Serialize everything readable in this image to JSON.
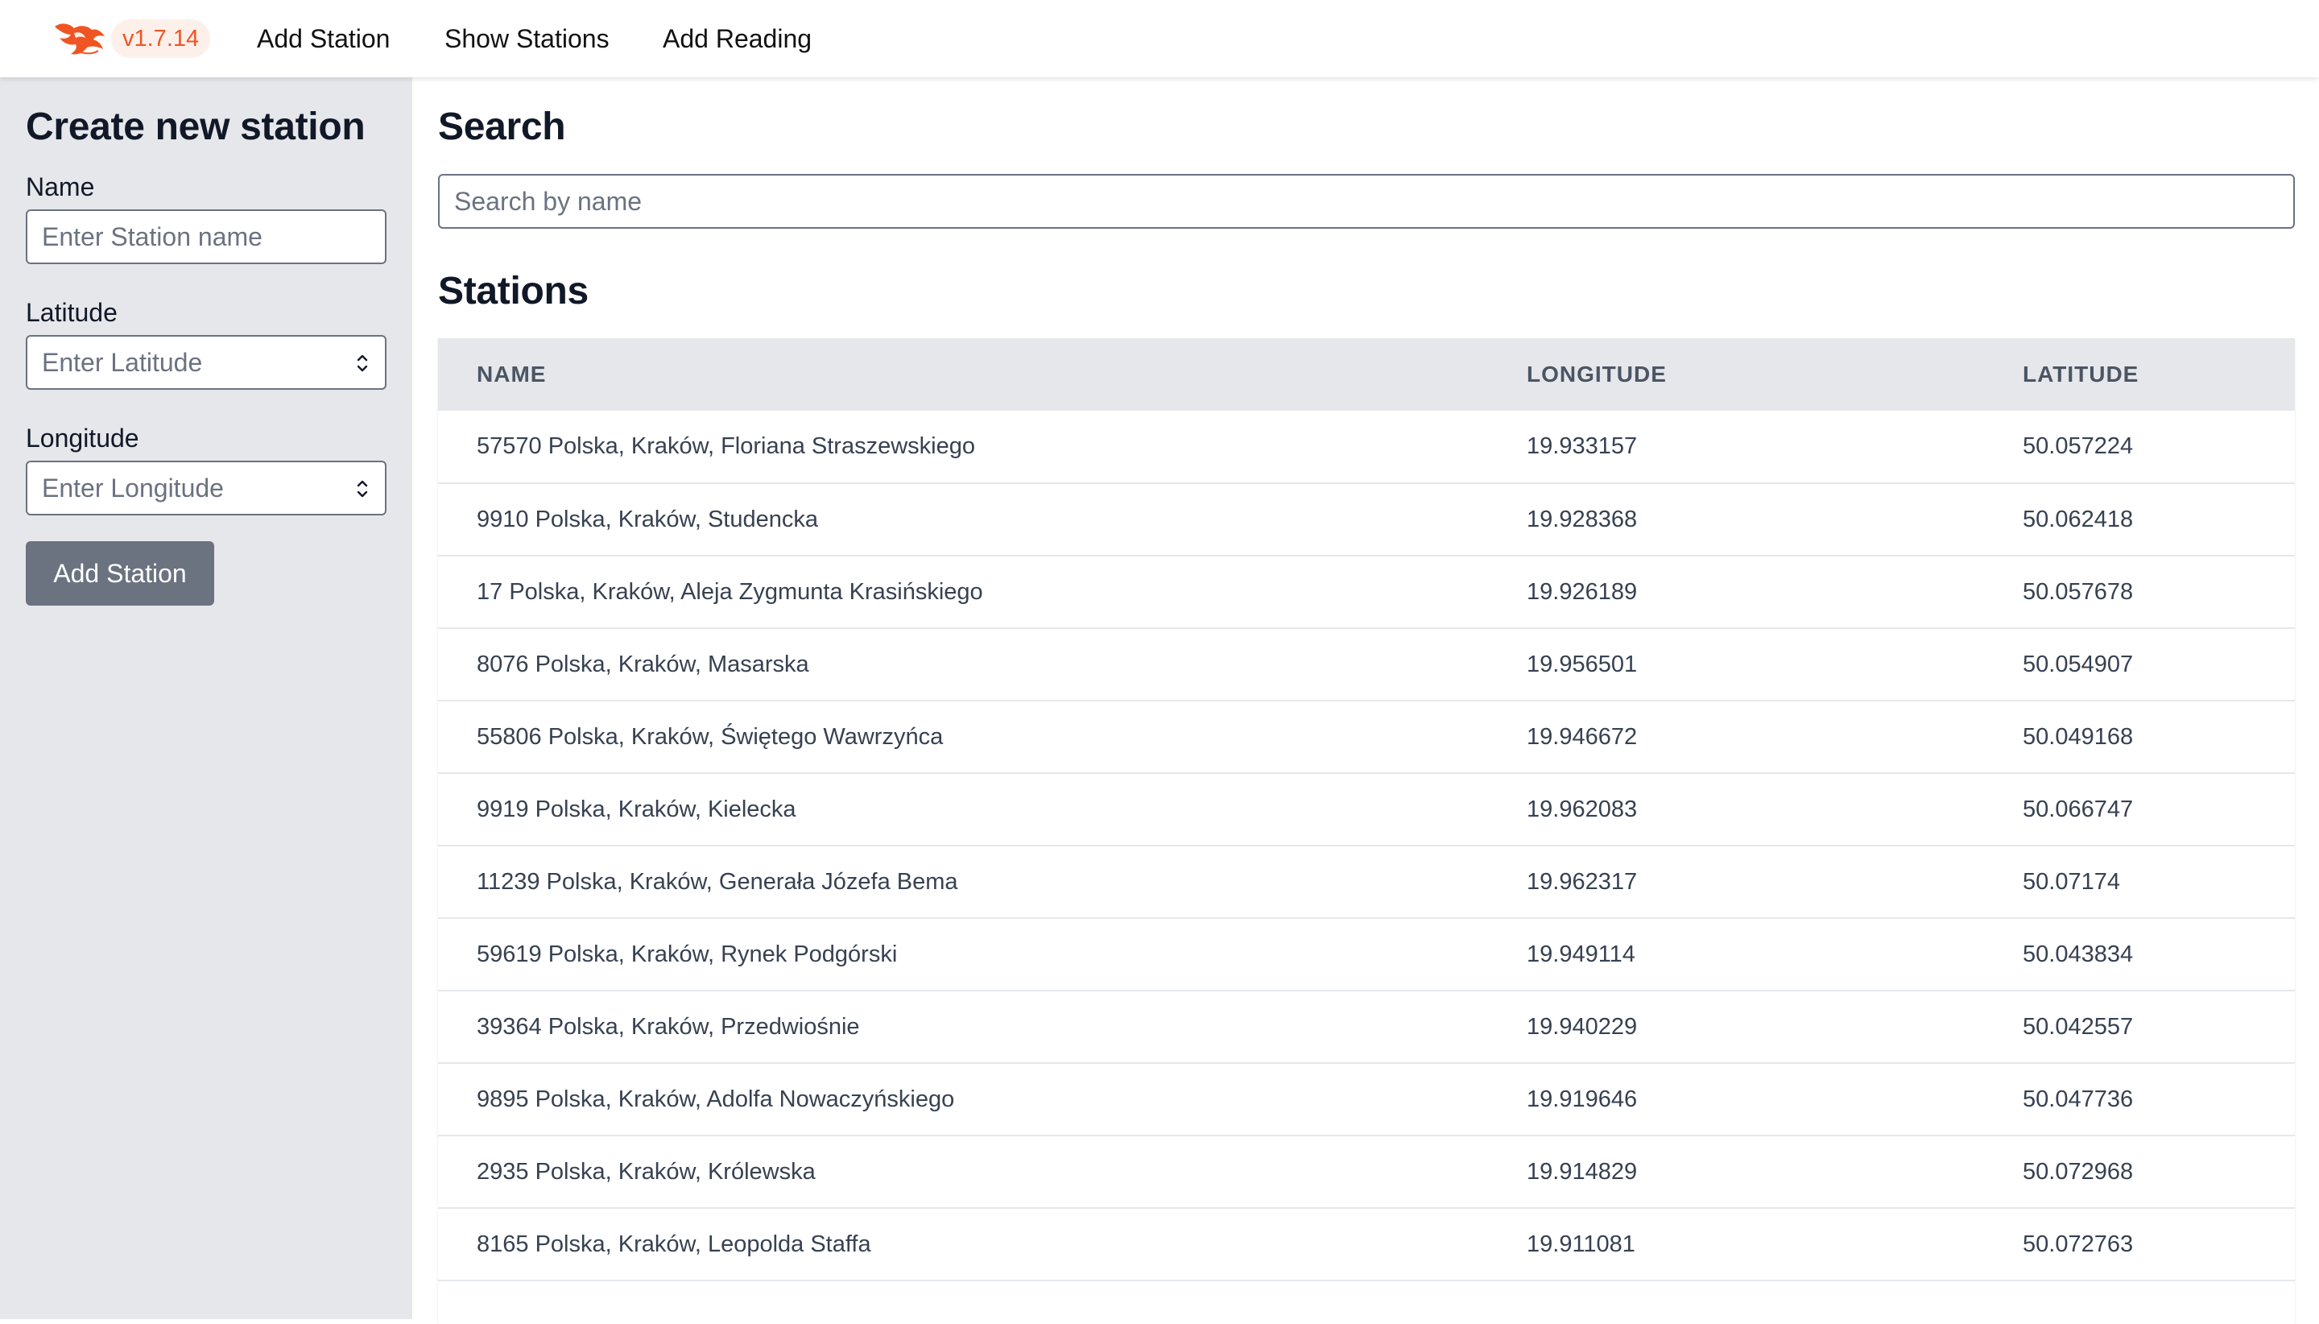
{
  "app": {
    "version": "v1.7.14",
    "brand_color": "#f05423",
    "logo_icon": "phoenix-logo-icon"
  },
  "nav": {
    "links": [
      {
        "label": "Add Station"
      },
      {
        "label": "Show Stations"
      },
      {
        "label": "Add Reading"
      }
    ]
  },
  "sidebar": {
    "title": "Create new station",
    "name_label": "Name",
    "name_placeholder": "Enter Station name",
    "latitude_label": "Latitude",
    "latitude_placeholder": "Enter Latitude",
    "longitude_label": "Longitude",
    "longitude_placeholder": "Enter Longitude",
    "submit_label": "Add Station"
  },
  "search": {
    "title": "Search",
    "placeholder": "Search by name"
  },
  "stations": {
    "title": "Stations",
    "columns": [
      "NAME",
      "LONGITUDE",
      "LATITUDE"
    ],
    "rows": [
      {
        "name": "57570 Polska, Kraków, Floriana Straszewskiego",
        "longitude": "19.933157",
        "latitude": "50.057224"
      },
      {
        "name": "9910 Polska, Kraków, Studencka",
        "longitude": "19.928368",
        "latitude": "50.062418"
      },
      {
        "name": "17 Polska, Kraków, Aleja Zygmunta Krasińskiego",
        "longitude": "19.926189",
        "latitude": "50.057678"
      },
      {
        "name": "8076 Polska, Kraków, Masarska",
        "longitude": "19.956501",
        "latitude": "50.054907"
      },
      {
        "name": "55806 Polska, Kraków, Świętego Wawrzyńca",
        "longitude": "19.946672",
        "latitude": "50.049168"
      },
      {
        "name": "9919 Polska, Kraków, Kielecka",
        "longitude": "19.962083",
        "latitude": "50.066747"
      },
      {
        "name": "11239 Polska, Kraków, Generała Józefa Bema",
        "longitude": "19.962317",
        "latitude": "50.07174"
      },
      {
        "name": "59619 Polska, Kraków, Rynek Podgórski",
        "longitude": "19.949114",
        "latitude": "50.043834"
      },
      {
        "name": "39364 Polska, Kraków, Przedwiośnie",
        "longitude": "19.940229",
        "latitude": "50.042557"
      },
      {
        "name": "9895 Polska, Kraków, Adolfa Nowaczyńskiego",
        "longitude": "19.919646",
        "latitude": "50.047736"
      },
      {
        "name": "2935 Polska, Kraków, Królewska",
        "longitude": "19.914829",
        "latitude": "50.072968"
      },
      {
        "name": "8165 Polska, Kraków, Leopolda Staffa",
        "longitude": "19.911081",
        "latitude": "50.072763"
      }
    ]
  }
}
